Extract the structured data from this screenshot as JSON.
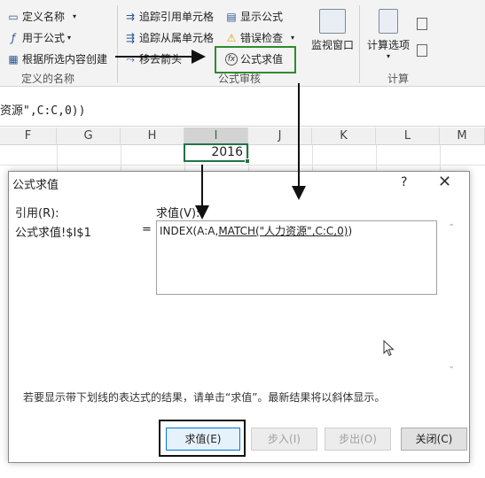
{
  "ribbon": {
    "names": {
      "define_name": "定义名称",
      "use_in_formula": "用于公式",
      "create_from_selection": "根据所选内容创建",
      "group_label": "定义的名称"
    },
    "audit": {
      "trace_precedents": "追踪引用单元格",
      "trace_dependents": "追踪从属单元格",
      "remove_arrows": "移去箭头",
      "show_formulas": "显示公式",
      "error_checking": "错误检查",
      "evaluate_formula": "公式求值",
      "watch_window": "监视窗口",
      "group_label": "公式审核"
    },
    "calc": {
      "calc_options": "计算选项",
      "group_label": "计算"
    }
  },
  "formula_bar": {
    "text": "资源\",C:C,0))"
  },
  "columns": [
    "F",
    "G",
    "H",
    "I",
    "J",
    "K",
    "L",
    "M"
  ],
  "selected_column": "I",
  "cell_value": "2016",
  "dialog": {
    "title": "公式求值",
    "help": "?",
    "close": "✕",
    "reference_label": "引用(R):",
    "evaluation_label": "求值(V):",
    "reference_value": "公式求值!$I$1",
    "equals": "=",
    "expression_prefix": "INDEX(A:A,",
    "expression_underlined": "MATCH(\"人力资源\",C:C,0)",
    "expression_suffix": ")",
    "hint": "若要显示带下划线的表达式的结果，请单击“求值”。最新结果将以斜体显示。",
    "buttons": {
      "evaluate": "求值(E)",
      "step_in": "步入(I)",
      "step_out": "步出(O)",
      "close": "关闭(C)"
    }
  },
  "colors": {
    "excel_green": "#217346",
    "highlight_green": "#2e8b2e",
    "focus_blue": "#0078d7"
  }
}
